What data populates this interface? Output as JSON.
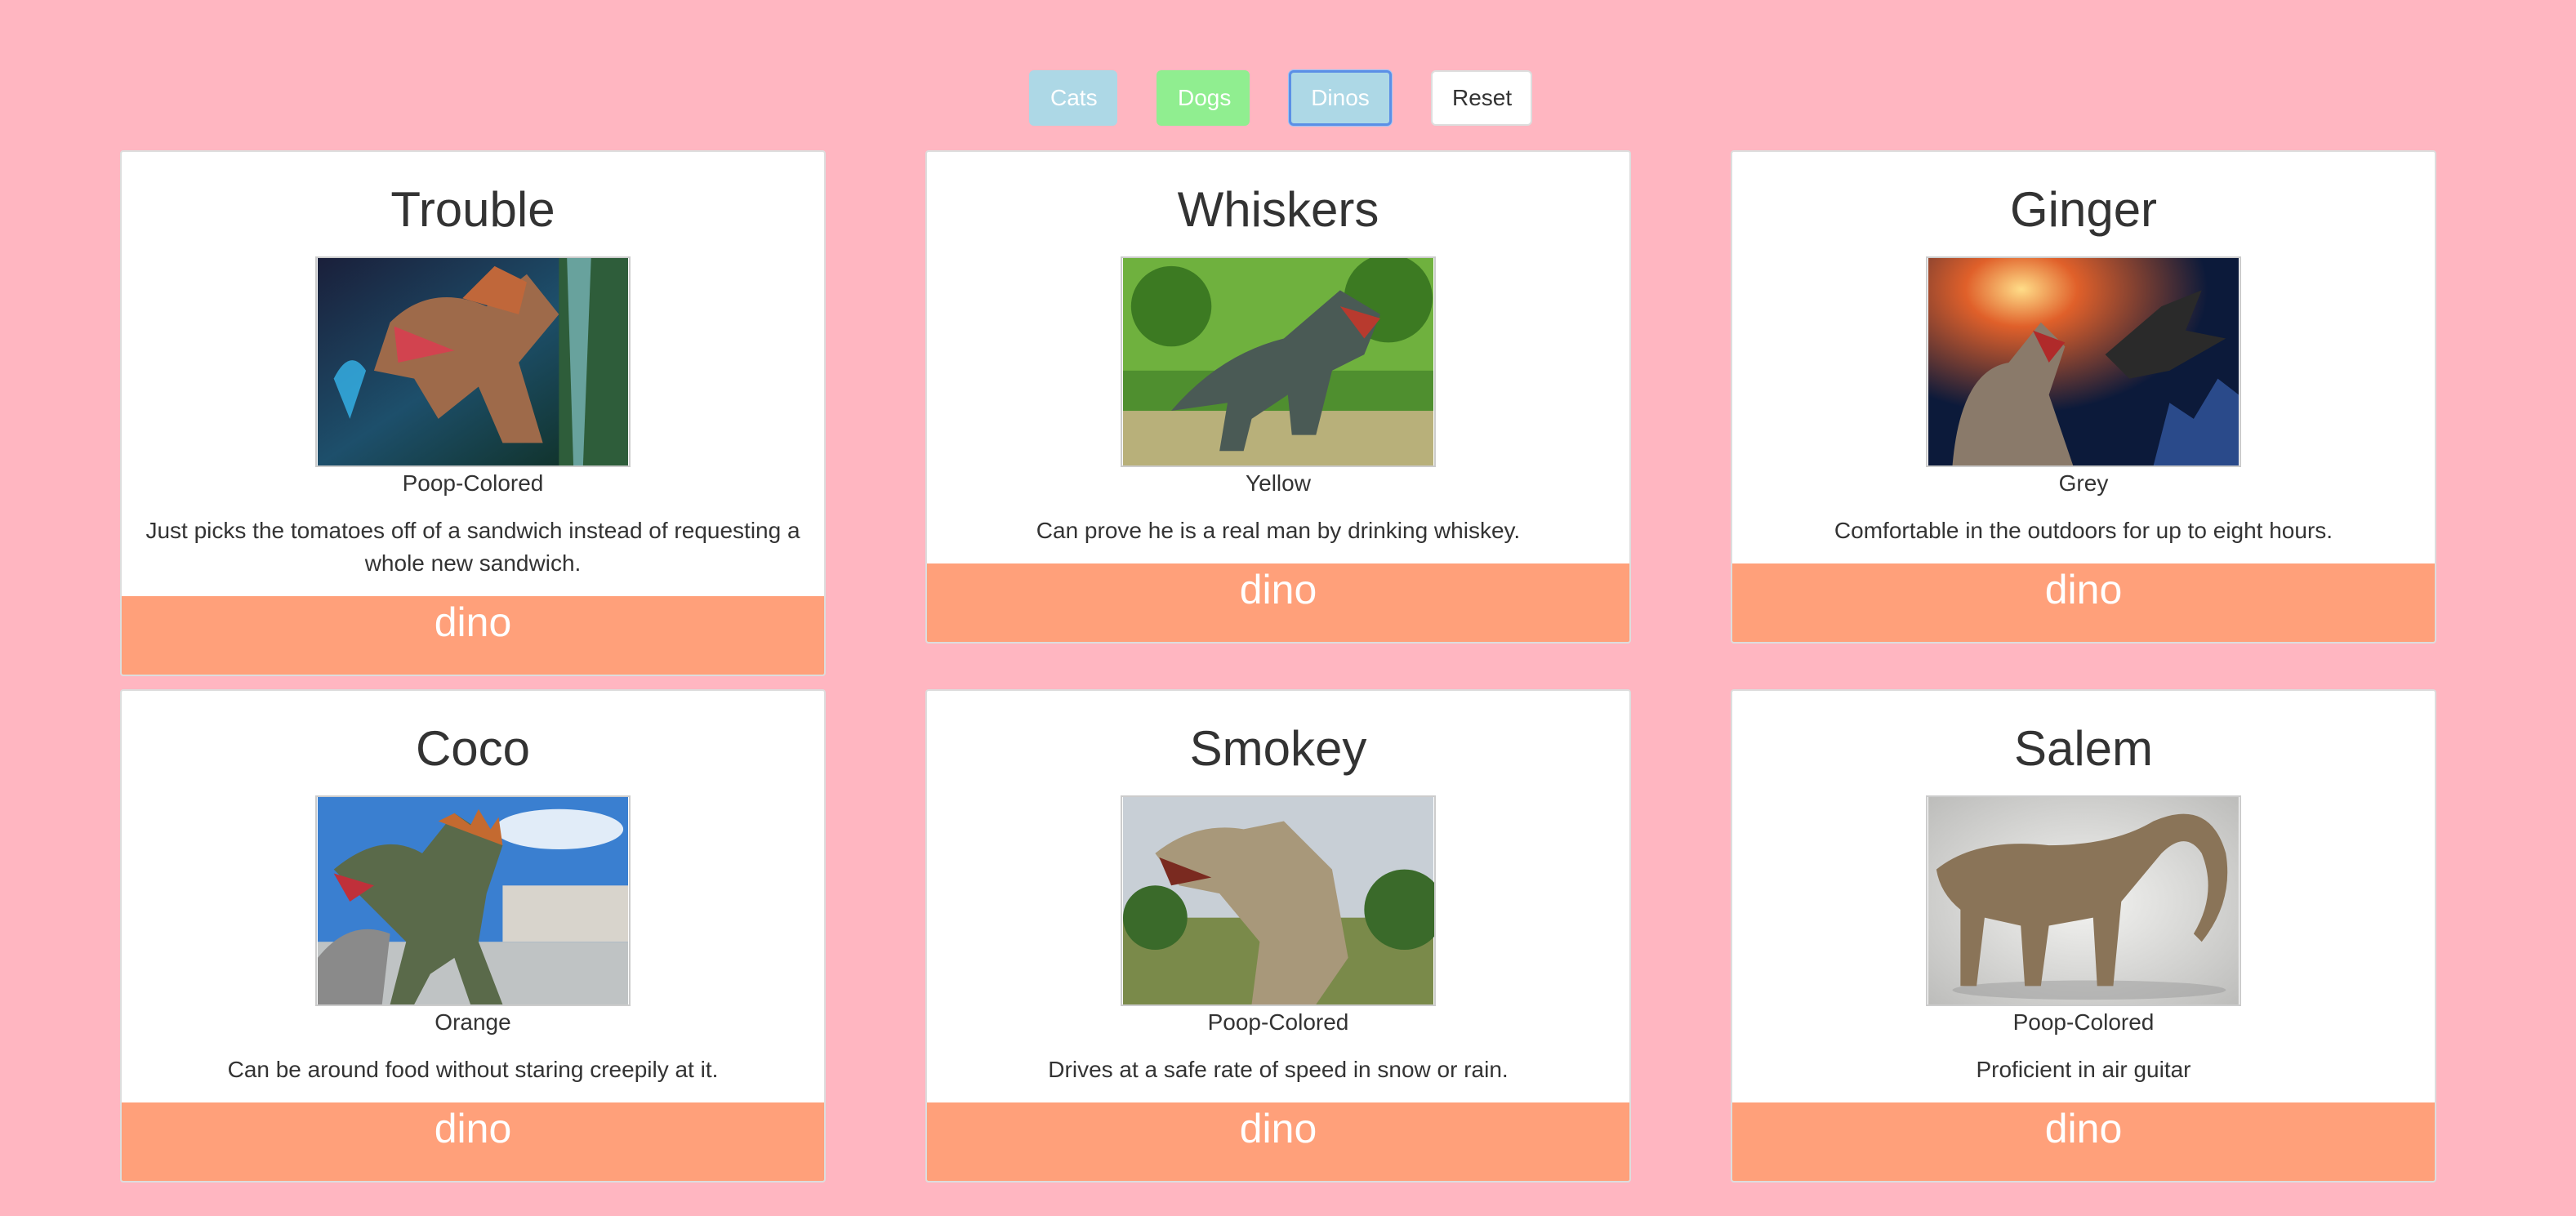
{
  "filters": {
    "cats": "Cats",
    "dogs": "Dogs",
    "dinos": "Dinos",
    "reset": "Reset"
  },
  "cards": [
    {
      "name": "Trouble",
      "color": "Poop-Colored",
      "description": "Just picks the tomatoes off of a sandwich instead of requesting a whole new sandwich.",
      "type": "dino"
    },
    {
      "name": "Whiskers",
      "color": "Yellow",
      "description": "Can prove he is a real man by drinking whiskey.",
      "type": "dino"
    },
    {
      "name": "Ginger",
      "color": "Grey",
      "description": "Comfortable in the outdoors for up to eight hours.",
      "type": "dino"
    },
    {
      "name": "Coco",
      "color": "Orange",
      "description": "Can be around food without staring creepily at it.",
      "type": "dino"
    },
    {
      "name": "Smokey",
      "color": "Poop-Colored",
      "description": "Drives at a safe rate of speed in snow or rain.",
      "type": "dino"
    },
    {
      "name": "Salem",
      "color": "Poop-Colored",
      "description": "Proficient in air guitar",
      "type": "dino"
    }
  ],
  "colors": {
    "background": "#ffb6c1",
    "card_footer": "#ffa07a",
    "cats_button": "#add8e6",
    "dogs_button": "#90ee90",
    "dinos_button": "#add8e6"
  }
}
